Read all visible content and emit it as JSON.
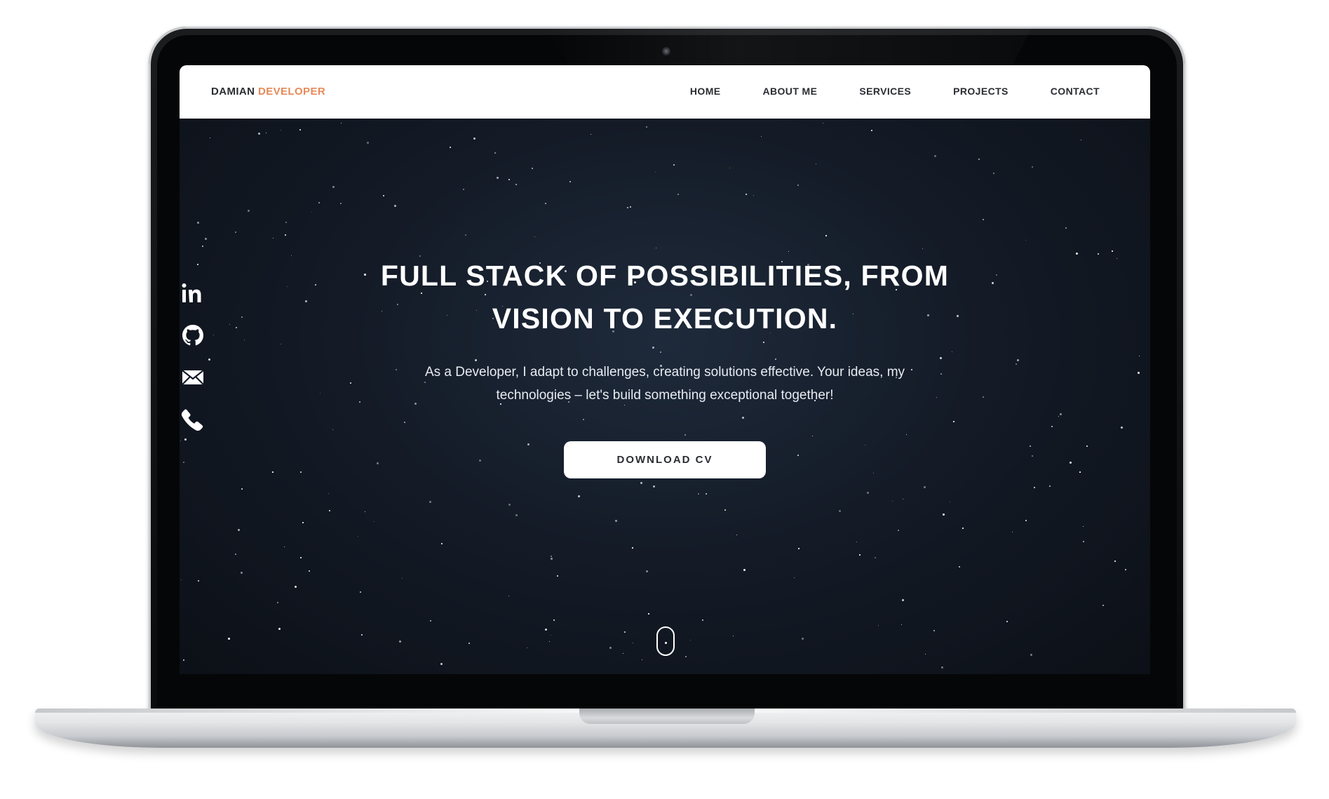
{
  "site": {
    "brand_primary": "DAMIAN",
    "brand_accent": "DEVELOPER",
    "brand_accent_color": "#e58a5a"
  },
  "nav": {
    "items": [
      {
        "label": "HOME"
      },
      {
        "label": "ABOUT ME"
      },
      {
        "label": "SERVICES"
      },
      {
        "label": "PROJECTS"
      },
      {
        "label": "CONTACT"
      }
    ]
  },
  "social": {
    "icons": [
      "linkedin-icon",
      "github-icon",
      "mail-icon",
      "phone-icon"
    ]
  },
  "hero": {
    "title_line1": "FULL STACK OF POSSIBILITIES, FROM",
    "title_line2": "VISION TO EXECUTION.",
    "subtitle_line1": "As a Developer, I adapt to challenges, creating solutions effective. Your ideas, my",
    "subtitle_line2": "technologies – let's build something exceptional together!",
    "cta_label": "DOWNLOAD CV"
  },
  "colors": {
    "hero_background": "#141b27",
    "header_background": "#ffffff",
    "text_dark": "#2b2d33"
  }
}
